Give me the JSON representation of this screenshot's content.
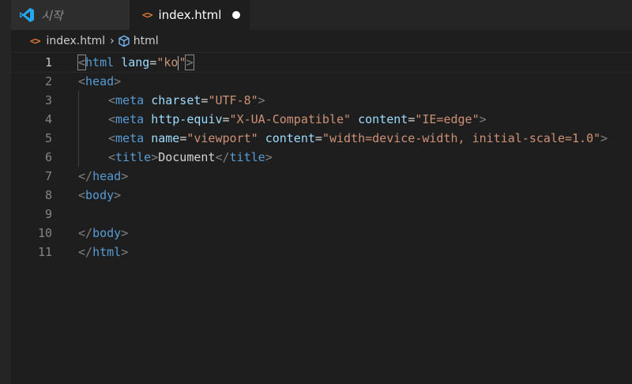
{
  "tabs": [
    {
      "label": "시작",
      "icon": "vscode-logo-icon"
    },
    {
      "label": "index.html",
      "icon": "html-file-icon",
      "dirty": true
    }
  ],
  "breadcrumb": {
    "file": "index.html",
    "symbol": "html"
  },
  "editor": {
    "active_line": 1,
    "lines": [
      {
        "n": "1",
        "parts": [
          [
            "t",
            "<"
          ],
          [
            "tg",
            "html"
          ],
          [
            "tx",
            " "
          ],
          [
            "at",
            "lang"
          ],
          [
            "tx",
            "="
          ],
          [
            "st",
            "\"ko"
          ],
          [
            "cursor",
            ""
          ],
          [
            "st",
            "\""
          ],
          [
            "t",
            ">"
          ]
        ]
      },
      {
        "n": "2",
        "parts": [
          [
            "t",
            "<"
          ],
          [
            "tg",
            "head"
          ],
          [
            "t",
            ">"
          ]
        ]
      },
      {
        "n": "3",
        "indent": 1,
        "parts": [
          [
            "t",
            "<"
          ],
          [
            "tg",
            "meta"
          ],
          [
            "tx",
            " "
          ],
          [
            "at",
            "charset"
          ],
          [
            "tx",
            "="
          ],
          [
            "st",
            "\"UTF-8\""
          ],
          [
            "t",
            ">"
          ]
        ]
      },
      {
        "n": "4",
        "indent": 1,
        "parts": [
          [
            "t",
            "<"
          ],
          [
            "tg",
            "meta"
          ],
          [
            "tx",
            " "
          ],
          [
            "at",
            "http-equiv"
          ],
          [
            "tx",
            "="
          ],
          [
            "st",
            "\"X-UA-Compatible\""
          ],
          [
            "tx",
            " "
          ],
          [
            "at",
            "content"
          ],
          [
            "tx",
            "="
          ],
          [
            "st",
            "\"IE=edge\""
          ],
          [
            "t",
            ">"
          ]
        ]
      },
      {
        "n": "5",
        "indent": 1,
        "parts": [
          [
            "t",
            "<"
          ],
          [
            "tg",
            "meta"
          ],
          [
            "tx",
            " "
          ],
          [
            "at",
            "name"
          ],
          [
            "tx",
            "="
          ],
          [
            "st",
            "\"viewport\""
          ],
          [
            "tx",
            " "
          ],
          [
            "at",
            "content"
          ],
          [
            "tx",
            "="
          ],
          [
            "st",
            "\"width=device-width, initial-scale=1.0\""
          ],
          [
            "t",
            ">"
          ]
        ]
      },
      {
        "n": "6",
        "indent": 1,
        "parts": [
          [
            "t",
            "<"
          ],
          [
            "tg",
            "title"
          ],
          [
            "t",
            ">"
          ],
          [
            "tx",
            "Document"
          ],
          [
            "t",
            "</"
          ],
          [
            "tg",
            "title"
          ],
          [
            "t",
            ">"
          ]
        ]
      },
      {
        "n": "7",
        "parts": [
          [
            "t",
            "</"
          ],
          [
            "tg",
            "head"
          ],
          [
            "t",
            ">"
          ]
        ]
      },
      {
        "n": "8",
        "parts": [
          [
            "t",
            "<"
          ],
          [
            "tg",
            "body"
          ],
          [
            "t",
            ">"
          ]
        ]
      },
      {
        "n": "9",
        "parts": []
      },
      {
        "n": "10",
        "parts": [
          [
            "t",
            "</"
          ],
          [
            "tg",
            "body"
          ],
          [
            "t",
            ">"
          ]
        ]
      },
      {
        "n": "11",
        "parts": [
          [
            "t",
            "</"
          ],
          [
            "tg",
            "html"
          ],
          [
            "t",
            ">"
          ]
        ]
      }
    ]
  }
}
